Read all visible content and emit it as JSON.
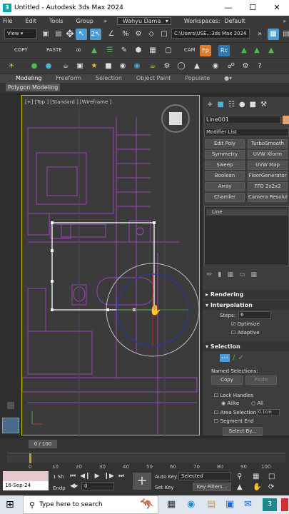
{
  "window": {
    "title": "Untitled - Autodesk 3ds Max 2024"
  },
  "menu": [
    "File",
    "Edit",
    "Tools",
    "Group",
    "»"
  ],
  "workspace": {
    "user": "Wahyu Dama",
    "label": "Workspaces:",
    "value": "Default"
  },
  "toolbar": {
    "view_mode": "View",
    "path": "C:\\Users\\USE...3ds Max 2024",
    "copy": "COPY",
    "paste": "PASTE",
    "cam": "CAM"
  },
  "ribbon": {
    "tabs": [
      "Modeling",
      "Freeform",
      "Selection",
      "Object Paint",
      "Populate"
    ],
    "sub": "Polygon Modeling"
  },
  "viewport": {
    "label": "[+] [Top ] [Standard ] [Wireframe ]"
  },
  "panel": {
    "object_name": "Line001",
    "modifier_list": "Modifier List",
    "modifiers": [
      "Edit Poly",
      "TurboSmooth",
      "Symmetry",
      "UVW Xform",
      "Sweep",
      "UVW Map",
      "Boolean",
      "FloorGenerator",
      "Array",
      "FFD 2x2x2",
      "Chamfer",
      "Camera Resolution"
    ],
    "stack_item": "Line",
    "rendering": "Rendering",
    "interpolation": "Interpolation",
    "steps_label": "Steps:",
    "steps_value": "6",
    "optimize": "Optimize",
    "adaptive": "Adaptive",
    "selection": "Selection",
    "named_selections": "Named Selections:",
    "copy": "Copy",
    "paste": "Paste",
    "lock_handles": "Lock Handles",
    "alike": "Alike",
    "all": "All",
    "area_selection": "Area Selection",
    "area_value": "0.1cm",
    "segment_end": "Segment End",
    "select_by": "Select By..."
  },
  "timeline": {
    "frame": "0 / 100",
    "ticks": [
      "0",
      "10",
      "20",
      "30",
      "40",
      "50",
      "60",
      "70",
      "80",
      "90",
      "100"
    ]
  },
  "status": {
    "date": "16-Sep-24",
    "lsh": "1 Sh",
    "endp": "Endp",
    "frame_value": "0",
    "auto_key": "Auto Key",
    "set_key": "Set Key",
    "selected": "Selected",
    "key_filters": "Key Filters..."
  },
  "taskbar": {
    "search_placeholder": "Type here to search"
  }
}
